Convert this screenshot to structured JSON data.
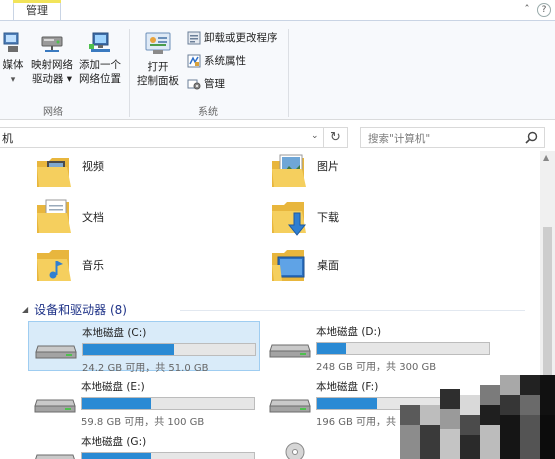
{
  "ribbon": {
    "tab_manage": "管理",
    "buttons": {
      "media_partial": "媒体",
      "map_drive_line1": "映射网络",
      "map_drive_line2": "驱动器 ▾",
      "add_location_line1": "添加一个",
      "add_location_line2": "网络位置",
      "open_cp_line1": "打开",
      "open_cp_line2": "控制面板",
      "uninstall": "卸载或更改程序",
      "sys_props": "系统属性",
      "manage": "管理"
    },
    "groups": {
      "network": "网络",
      "system": "系统"
    },
    "controls": {
      "collapse": "ˆ",
      "help": "?"
    }
  },
  "address": {
    "path_partial": "机",
    "dropdown": "⌄",
    "refresh": "↻"
  },
  "search": {
    "placeholder": "搜索\"计算机\""
  },
  "folders": [
    {
      "label": "视频",
      "icon": "video-folder-icon"
    },
    {
      "label": "图片",
      "icon": "pictures-folder-icon"
    },
    {
      "label": "文档",
      "icon": "documents-folder-icon"
    },
    {
      "label": "下载",
      "icon": "downloads-folder-icon"
    },
    {
      "label": "音乐",
      "icon": "music-folder-icon"
    },
    {
      "label": "桌面",
      "icon": "desktop-folder-icon"
    }
  ],
  "devices": {
    "header": "设备和驱动器 (8)",
    "drives": [
      {
        "name": "本地磁盘 (C:)",
        "info": "24.2 GB 可用，共 51.0 GB",
        "used_fraction": 0.53
      },
      {
        "name": "本地磁盘 (D:)",
        "info": "248 GB 可用，共 300 GB",
        "used_fraction": 0.17
      },
      {
        "name": "本地磁盘 (E:)",
        "info": "59.8 GB 可用，共 100 GB",
        "used_fraction": 0.4
      },
      {
        "name": "本地磁盘 (F:)",
        "info": "196 GB 可用，共 300 GB",
        "used_fraction": 0.35
      },
      {
        "name": "本地磁盘 (G:)",
        "info": "",
        "used_fraction": 0.4
      }
    ]
  },
  "colors": {
    "accent": "#2a8ad4",
    "selected_bg": "#d9ebf9",
    "section_header": "#1e3287",
    "folder_yellow": "#f2c94c"
  }
}
